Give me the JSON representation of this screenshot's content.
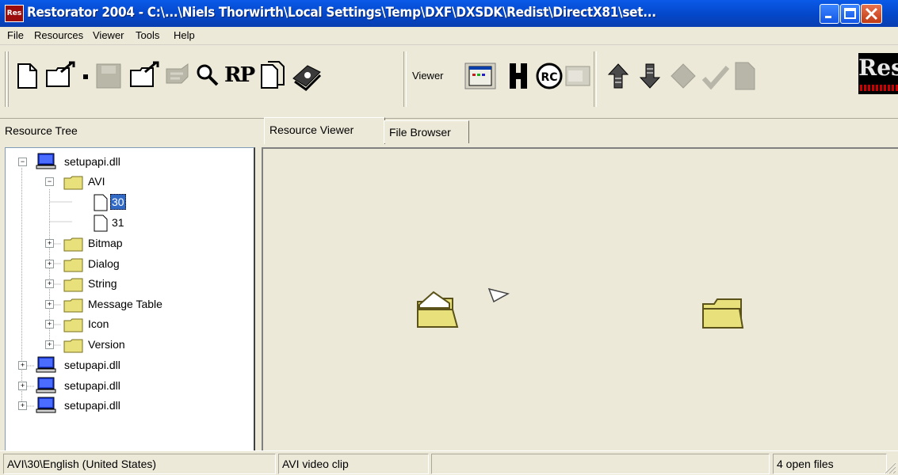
{
  "window": {
    "app_icon_text": "Res",
    "title": "Restorator 2004 - C:\\...\\Niels Thorwirth\\Local Settings\\Temp\\DXF\\DXSDK\\Redist\\DirectX81\\set..."
  },
  "menu": [
    "File",
    "Resources",
    "Viewer",
    "Tools",
    "Help"
  ],
  "toolbar": {
    "viewer_label": "Viewer",
    "rp_label": "RP",
    "rc_label": "RC",
    "logo_text": "Res"
  },
  "panels": {
    "tree_header": "Resource Tree",
    "tabs": [
      "Resource Viewer",
      "File Browser"
    ]
  },
  "tree": {
    "root": "setupapi.dll",
    "avi_folder": "AVI",
    "avi_items": [
      "30",
      "31"
    ],
    "folders": [
      "Bitmap",
      "Dialog",
      "String",
      "Message Table",
      "Icon",
      "Version"
    ],
    "other_files": [
      "setupapi.dll",
      "setupapi.dll",
      "setupapi.dll"
    ]
  },
  "status": {
    "path": "AVI\\30\\English (United States)",
    "type": "AVI video clip",
    "empty": "",
    "open_files": "4 open files"
  },
  "colors": {
    "title_bar": "#0a5ae8",
    "selection": "#316ac5",
    "folder": "#e8e07a"
  }
}
